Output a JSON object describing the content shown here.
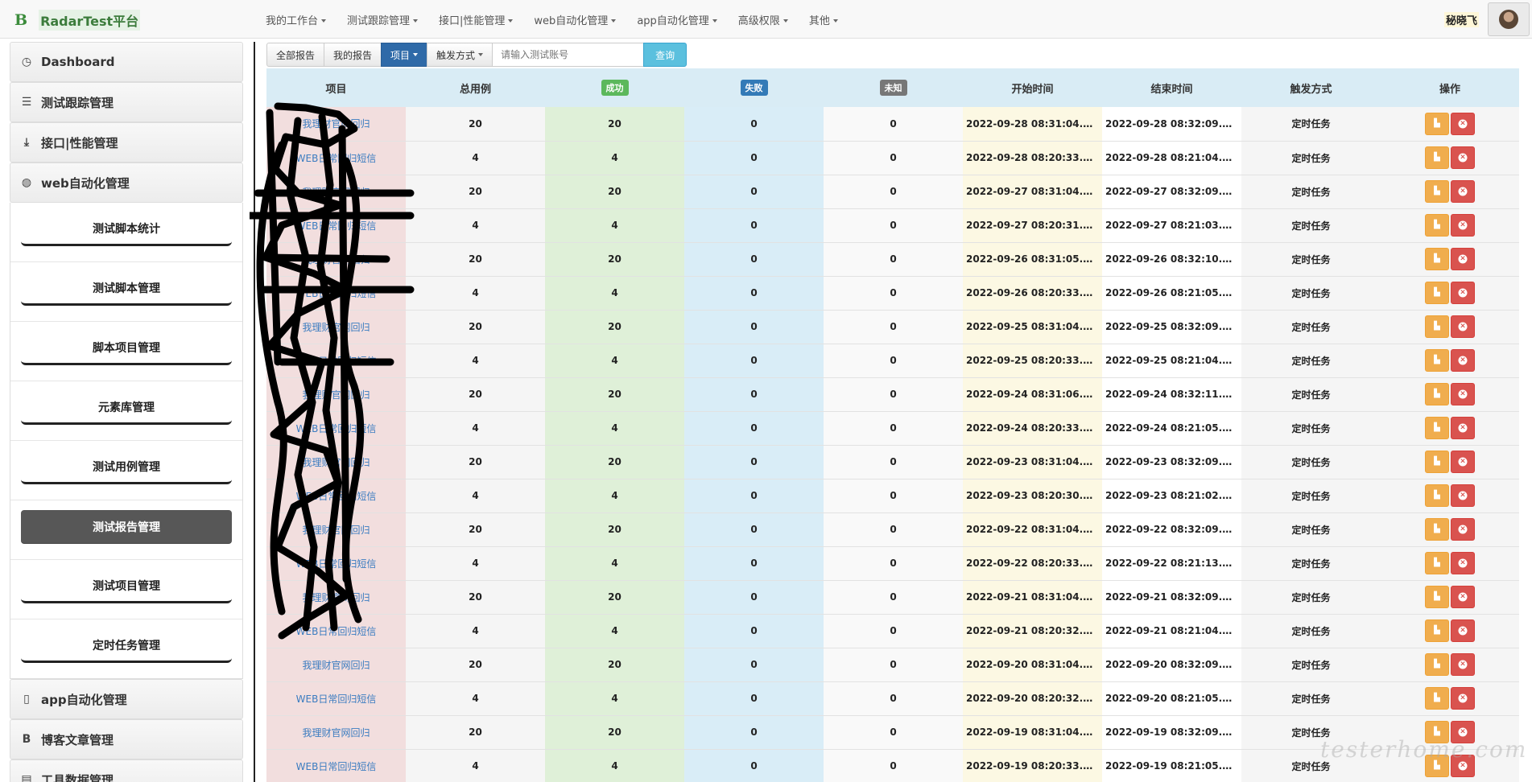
{
  "navbar": {
    "logo": "B",
    "brand": "RadarTest平台",
    "menus": [
      "我的工作台",
      "测试跟踪管理",
      "接口|性能管理",
      "web自动化管理",
      "app自动化管理",
      "高级权限",
      "其他"
    ],
    "user": "秘晓飞"
  },
  "sidebar": {
    "items": [
      {
        "label": "Dashboard",
        "icon": "clock-icon"
      },
      {
        "label": "测试跟踪管理",
        "icon": "list-icon"
      },
      {
        "label": "接口|性能管理",
        "icon": "download-icon"
      },
      {
        "label": "web自动化管理",
        "icon": "globe-icon"
      }
    ],
    "sub_items": [
      "测试脚本统计",
      "测试脚本管理",
      "脚本项目管理",
      "元素库管理",
      "测试用例管理",
      "测试报告管理",
      "测试项目管理",
      "定时任务管理"
    ],
    "active_sub": "测试报告管理",
    "bottom_items": [
      {
        "label": "app自动化管理",
        "icon": "mobile-icon"
      },
      {
        "label": "博客文章管理",
        "icon": "bold-b-icon"
      },
      {
        "label": "工具数据管理",
        "icon": "briefcase-icon"
      }
    ]
  },
  "toolbar": {
    "all_reports": "全部报告",
    "my_reports": "我的报告",
    "project": "项目",
    "trigger": "触发方式",
    "search_placeholder": "请输入测试账号",
    "search_button": "查询"
  },
  "table": {
    "headers": {
      "project": "项目",
      "total": "总用例",
      "success": "成功",
      "fail": "失败",
      "unknown": "未知",
      "start": "开始时间",
      "end": "结束时间",
      "trigger": "触发方式",
      "ops": "操作"
    },
    "rows": [
      {
        "project": "我理财官网回归",
        "total": "20",
        "success": "20",
        "fail": "0",
        "unknown": "0",
        "start": "2022-09-28 08:31:04.529...",
        "end": "2022-09-28 08:32:09.452...",
        "trigger": "定时任务"
      },
      {
        "project": "WEB日常回归短信",
        "total": "4",
        "success": "4",
        "fail": "0",
        "unknown": "0",
        "start": "2022-09-28 08:20:33.347...",
        "end": "2022-09-28 08:21:04.742...",
        "trigger": "定时任务"
      },
      {
        "project": "我理财官网回归",
        "total": "20",
        "success": "20",
        "fail": "0",
        "unknown": "0",
        "start": "2022-09-27 08:31:04.508...",
        "end": "2022-09-27 08:32:09.525...",
        "trigger": "定时任务"
      },
      {
        "project": "WEB日常回归短信",
        "total": "4",
        "success": "4",
        "fail": "0",
        "unknown": "0",
        "start": "2022-09-27 08:20:31.079...",
        "end": "2022-09-27 08:21:03.134...",
        "trigger": "定时任务"
      },
      {
        "project": "我理财官网回归",
        "total": "20",
        "success": "20",
        "fail": "0",
        "unknown": "0",
        "start": "2022-09-26 08:31:05.152...",
        "end": "2022-09-26 08:32:10.191...",
        "trigger": "定时任务"
      },
      {
        "project": "WEB日常回归短信",
        "total": "4",
        "success": "4",
        "fail": "0",
        "unknown": "0",
        "start": "2022-09-26 08:20:33.164...",
        "end": "2022-09-26 08:21:05.330...",
        "trigger": "定时任务"
      },
      {
        "project": "我理财官网回归",
        "total": "20",
        "success": "20",
        "fail": "0",
        "unknown": "0",
        "start": "2022-09-25 08:31:04.434...",
        "end": "2022-09-25 08:32:09.328...",
        "trigger": "定时任务"
      },
      {
        "project": "WEB日常回归短信",
        "total": "4",
        "success": "4",
        "fail": "0",
        "unknown": "0",
        "start": "2022-09-25 08:20:33.327...",
        "end": "2022-09-25 08:21:04.456...",
        "trigger": "定时任务"
      },
      {
        "project": "我理财官网回归",
        "total": "20",
        "success": "20",
        "fail": "0",
        "unknown": "0",
        "start": "2022-09-24 08:31:06.991...",
        "end": "2022-09-24 08:32:11.994...",
        "trigger": "定时任务"
      },
      {
        "project": "WEB日常回归短信",
        "total": "4",
        "success": "4",
        "fail": "0",
        "unknown": "0",
        "start": "2022-09-24 08:20:33.104...",
        "end": "2022-09-24 08:21:05.101...",
        "trigger": "定时任务"
      },
      {
        "project": "我理财官网回归",
        "total": "20",
        "success": "20",
        "fail": "0",
        "unknown": "0",
        "start": "2022-09-23 08:31:04.322...",
        "end": "2022-09-23 08:32:09.239...",
        "trigger": "定时任务"
      },
      {
        "project": "WEB日常回归短信",
        "total": "4",
        "success": "4",
        "fail": "0",
        "unknown": "0",
        "start": "2022-09-23 08:20:30.590...",
        "end": "2022-09-23 08:21:02.260...",
        "trigger": "定时任务"
      },
      {
        "project": "我理财官网回归",
        "total": "20",
        "success": "20",
        "fail": "0",
        "unknown": "0",
        "start": "2022-09-22 08:31:04.538...",
        "end": "2022-09-22 08:32:09.667...",
        "trigger": "定时任务"
      },
      {
        "project": "WEB日常回归短信",
        "total": "4",
        "success": "4",
        "fail": "0",
        "unknown": "0",
        "start": "2022-09-22 08:20:33.214...",
        "end": "2022-09-22 08:21:13.573...",
        "trigger": "定时任务"
      },
      {
        "project": "我理财官网回归",
        "total": "20",
        "success": "20",
        "fail": "0",
        "unknown": "0",
        "start": "2022-09-21 08:31:04.370...",
        "end": "2022-09-21 08:32:09.637...",
        "trigger": "定时任务"
      },
      {
        "project": "WEB日常回归短信",
        "total": "4",
        "success": "4",
        "fail": "0",
        "unknown": "0",
        "start": "2022-09-21 08:20:32.698...",
        "end": "2022-09-21 08:21:04.980...",
        "trigger": "定时任务"
      },
      {
        "project": "我理财官网回归",
        "total": "20",
        "success": "20",
        "fail": "0",
        "unknown": "0",
        "start": "2022-09-20 08:31:04.775...",
        "end": "2022-09-20 08:32:09.493...",
        "trigger": "定时任务"
      },
      {
        "project": "WEB日常回归短信",
        "total": "4",
        "success": "4",
        "fail": "0",
        "unknown": "0",
        "start": "2022-09-20 08:20:32.661...",
        "end": "2022-09-20 08:21:05.099...",
        "trigger": "定时任务"
      },
      {
        "project": "我理财官网回归",
        "total": "20",
        "success": "20",
        "fail": "0",
        "unknown": "0",
        "start": "2022-09-19 08:31:04.674...",
        "end": "2022-09-19 08:32:09.842...",
        "trigger": "定时任务"
      },
      {
        "project": "WEB日常回归短信",
        "total": "4",
        "success": "4",
        "fail": "0",
        "unknown": "0",
        "start": "2022-09-19 08:20:33.792...",
        "end": "2022-09-19 08:21:05.040...",
        "trigger": "定时任务"
      }
    ]
  },
  "colors": {
    "project_col": "#f2dede",
    "success_col": "#dff0d8",
    "fail_col": "#d9edf7",
    "start_col": "#fcf8e3",
    "header_bg": "#d9ecf5",
    "report_button": "#f0ad4e",
    "delete_button": "#d9534f",
    "active_menu": "#575757"
  },
  "watermark": "testerhome.com"
}
